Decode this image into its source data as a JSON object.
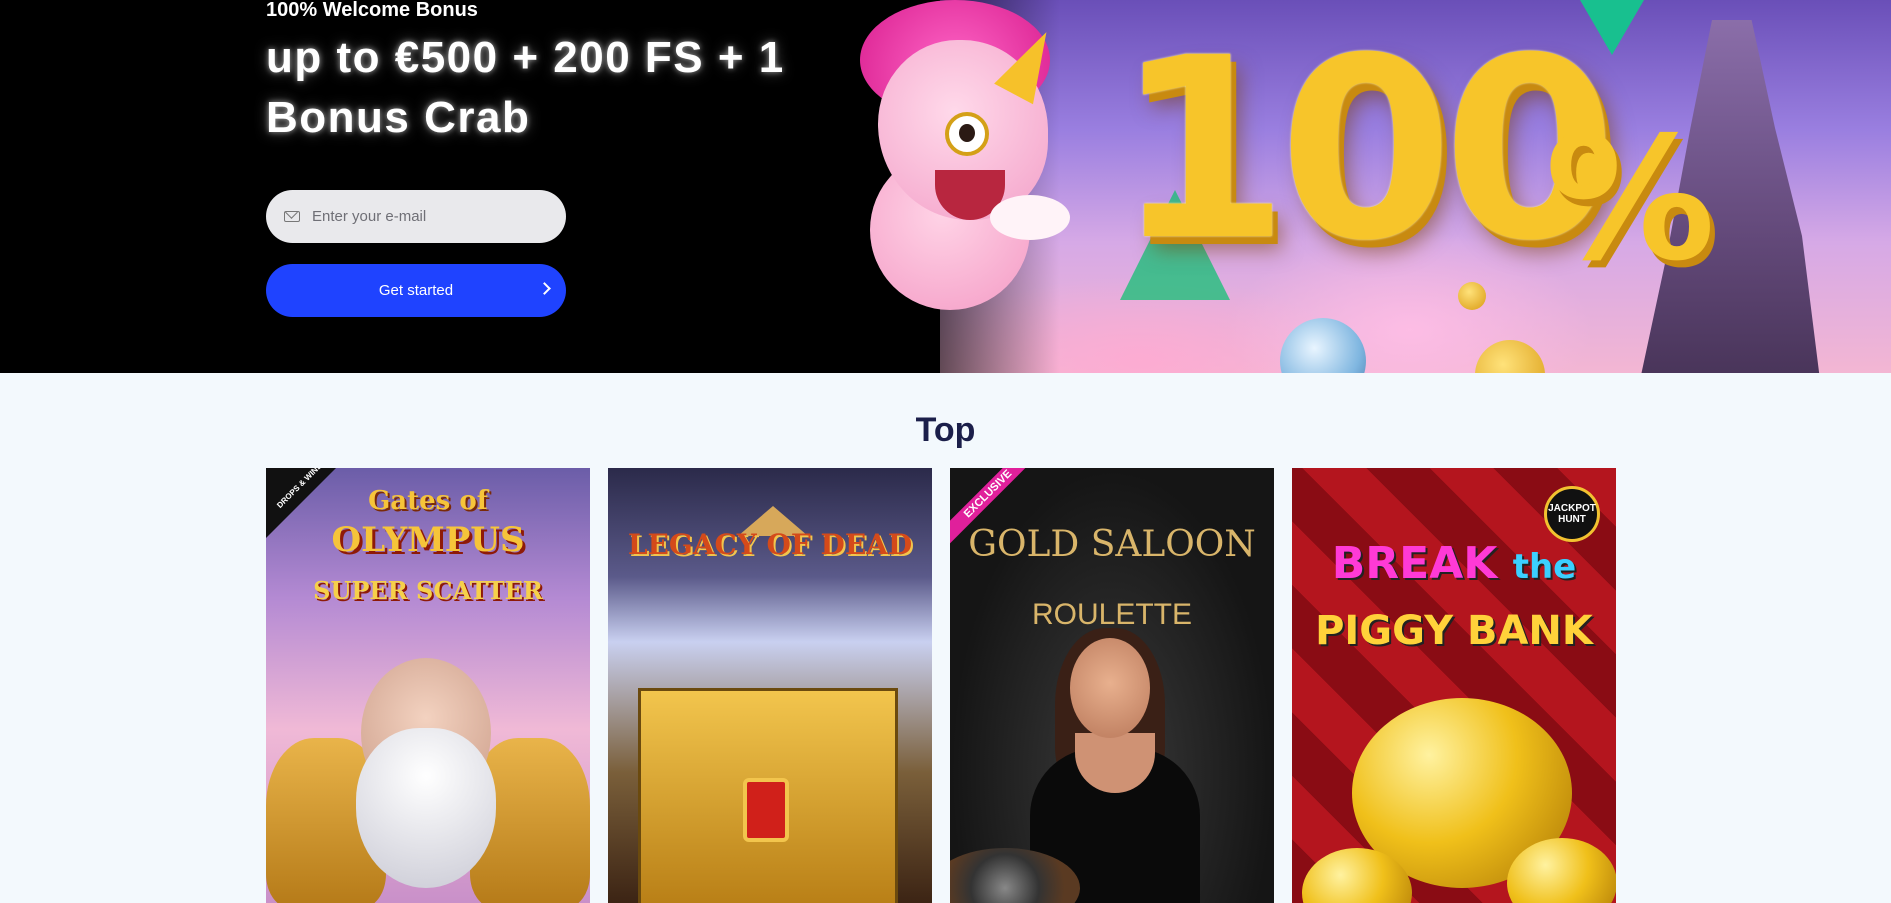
{
  "hero": {
    "subtitle": "100% Welcome Bonus",
    "title": "up to €500 + 200 FS + 1 Bonus Crab",
    "email": {
      "placeholder": "Enter your e-mail",
      "value": ""
    },
    "cta_label": "Get started",
    "art_text": {
      "number": "100",
      "percent": "%"
    }
  },
  "top": {
    "title": "Top",
    "games": [
      {
        "name_line1": "Gates of",
        "name_line2": "OLYMPUS",
        "name_line3": "SUPER SCATTER",
        "badge": "DROPS & WINS"
      },
      {
        "name_line1": "LEGACY OF DEAD"
      },
      {
        "name_line1": "GOLD SALOON",
        "name_line2": "ROULETTE",
        "badge": "EXCLUSIVE"
      },
      {
        "name_line1": "BREAK",
        "name_word": "the",
        "name_line2": "PIGGY BANK",
        "badge": "JACKPOT HUNT"
      }
    ]
  },
  "colors": {
    "cta": "#1f43ff",
    "heading": "#1b1f4a",
    "page_bg": "#f3f9fd",
    "hero_bg": "#000000"
  },
  "icons": [
    "mail-icon",
    "chevron-right-icon"
  ]
}
